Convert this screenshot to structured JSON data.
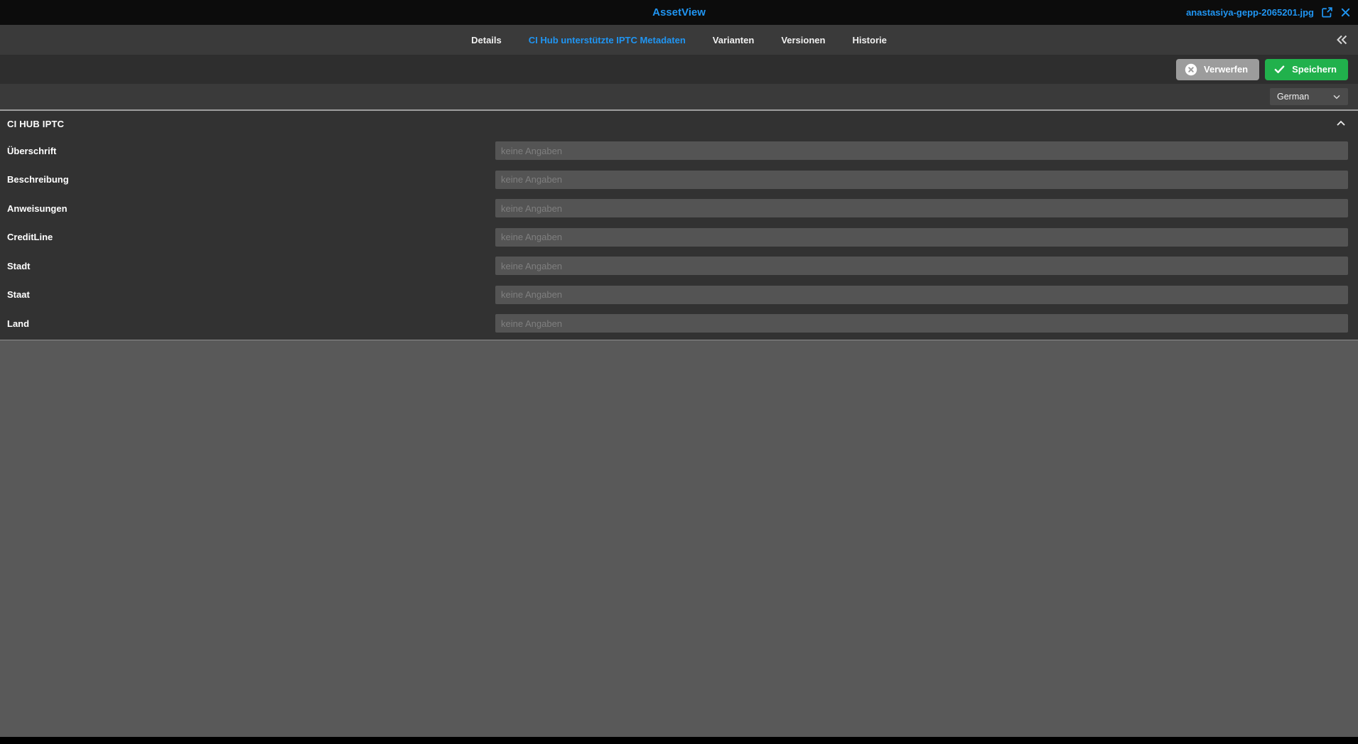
{
  "header": {
    "title": "AssetView",
    "filename": "anastasiya-gepp-2065201.jpg"
  },
  "tabs": [
    {
      "label": "Details",
      "active": false
    },
    {
      "label": "CI Hub unterstützte IPTC Metadaten",
      "active": true
    },
    {
      "label": "Varianten",
      "active": false
    },
    {
      "label": "Versionen",
      "active": false
    },
    {
      "label": "Historie",
      "active": false
    }
  ],
  "toolbar": {
    "discard_label": "Verwerfen",
    "save_label": "Speichern"
  },
  "language_select": {
    "value": "German"
  },
  "section": {
    "title": "CI HUB IPTC",
    "fields": [
      {
        "label": "Überschrift",
        "placeholder": "keine Angaben",
        "value": ""
      },
      {
        "label": "Beschreibung",
        "placeholder": "keine Angaben",
        "value": ""
      },
      {
        "label": "Anweisungen",
        "placeholder": "keine Angaben",
        "value": ""
      },
      {
        "label": "CreditLine",
        "placeholder": "keine Angaben",
        "value": ""
      },
      {
        "label": "Stadt",
        "placeholder": "keine Angaben",
        "value": ""
      },
      {
        "label": "Staat",
        "placeholder": "keine Angaben",
        "value": ""
      },
      {
        "label": "Land",
        "placeholder": "keine Angaben",
        "value": ""
      }
    ]
  },
  "icons": {
    "share": "share-export-icon",
    "close": "close-icon",
    "collapse_panel": "double-chevron-left-icon",
    "section_collapse": "chevron-up-icon",
    "language_dropdown": "chevron-down-icon",
    "discard": "circle-x-icon",
    "save": "check-icon"
  },
  "colors": {
    "accent_blue": "#2095f2",
    "save_green": "#21b14c",
    "discard_gray": "#9c9c9c",
    "topbar_bg": "#0c0c0c",
    "tabbar_bg": "#3a3a3a",
    "section_bg": "#323232",
    "backdrop_bg": "#595959"
  }
}
